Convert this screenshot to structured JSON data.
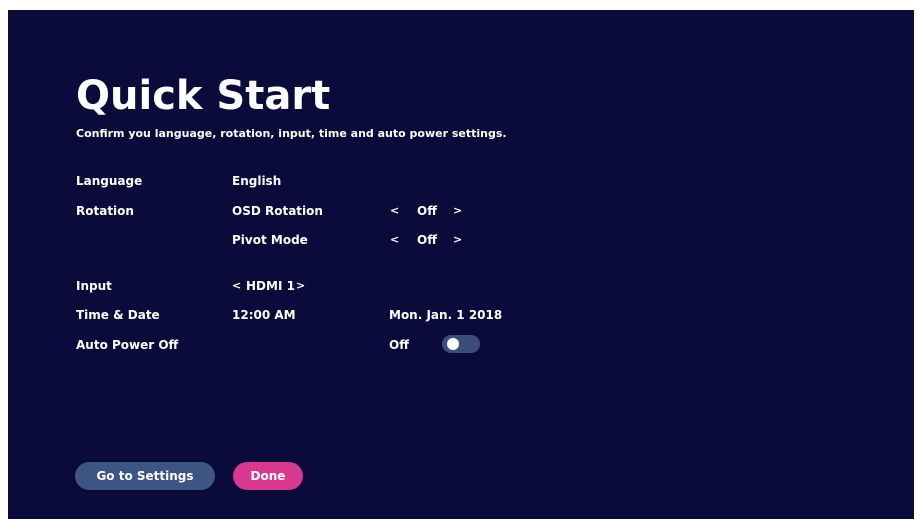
{
  "header": {
    "title": "Quick Start",
    "subtitle": "Confirm you language, rotation, input, time and auto power settings."
  },
  "settings": {
    "language": {
      "label": "Language",
      "value": "English"
    },
    "rotation": {
      "label": "Rotation",
      "osd_rotation": {
        "label": "OSD Rotation",
        "value": "Off",
        "prev": "<",
        "next": ">"
      },
      "pivot_mode": {
        "label": "Pivot Mode",
        "value": "Off",
        "prev": "<",
        "next": ">"
      }
    },
    "input": {
      "label": "Input",
      "value": "HDMI 1",
      "prev": "<",
      "next": ">"
    },
    "time_date": {
      "label": "Time & Date",
      "time": "12:00 AM",
      "date": "Mon. Jan. 1 2018"
    },
    "auto_power_off": {
      "label": "Auto Power Off",
      "value": "Off",
      "toggle_on": false
    }
  },
  "buttons": {
    "go_to_settings": "Go to Settings",
    "done": "Done"
  },
  "colors": {
    "background": "#0b0b3b",
    "text": "#ffffff",
    "settings_button": "#3d5582",
    "done_button": "#d6398e",
    "toggle_track": "#3d4d7a"
  }
}
